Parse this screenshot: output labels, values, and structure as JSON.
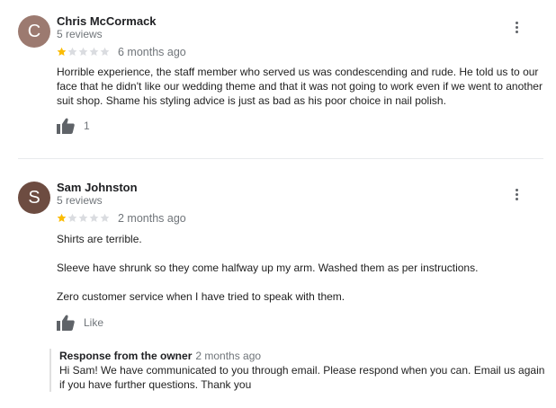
{
  "reviews": [
    {
      "initial": "C",
      "avatar_color": "#9c7a70",
      "name": "Chris McCormack",
      "review_count": "5 reviews",
      "rating": 1,
      "max_rating": 5,
      "age": "6 months ago",
      "paragraphs": [
        "Horrible experience, the staff member who served us was condescending and rude. He told us to our face that he didn't like our wedding theme and that it was not going to work even if we went to another suit shop. Shame his styling advice is just as bad as his poor choice in nail polish."
      ],
      "like_label": "1"
    },
    {
      "initial": "S",
      "avatar_color": "#6d4c41",
      "name": "Sam Johnston",
      "review_count": "5 reviews",
      "rating": 1,
      "max_rating": 5,
      "age": "2 months ago",
      "paragraphs": [
        "Shirts are terrible.",
        "Sleeve have shrunk so they come halfway up my arm. Washed them as per instructions.",
        "Zero customer service when I have tried to speak with them."
      ],
      "like_label": "Like",
      "response": {
        "title": "Response from the owner",
        "age": "2 months ago",
        "text": "Hi Sam! We have communicated to you through email. Please respond when you can. Email us again if you have further questions. Thank you"
      }
    }
  ],
  "colors": {
    "star_filled": "#fbbc04",
    "star_empty": "#dadce0"
  },
  "icons": {
    "more": "more-vertical-icon",
    "like": "thumbs-up-icon"
  }
}
